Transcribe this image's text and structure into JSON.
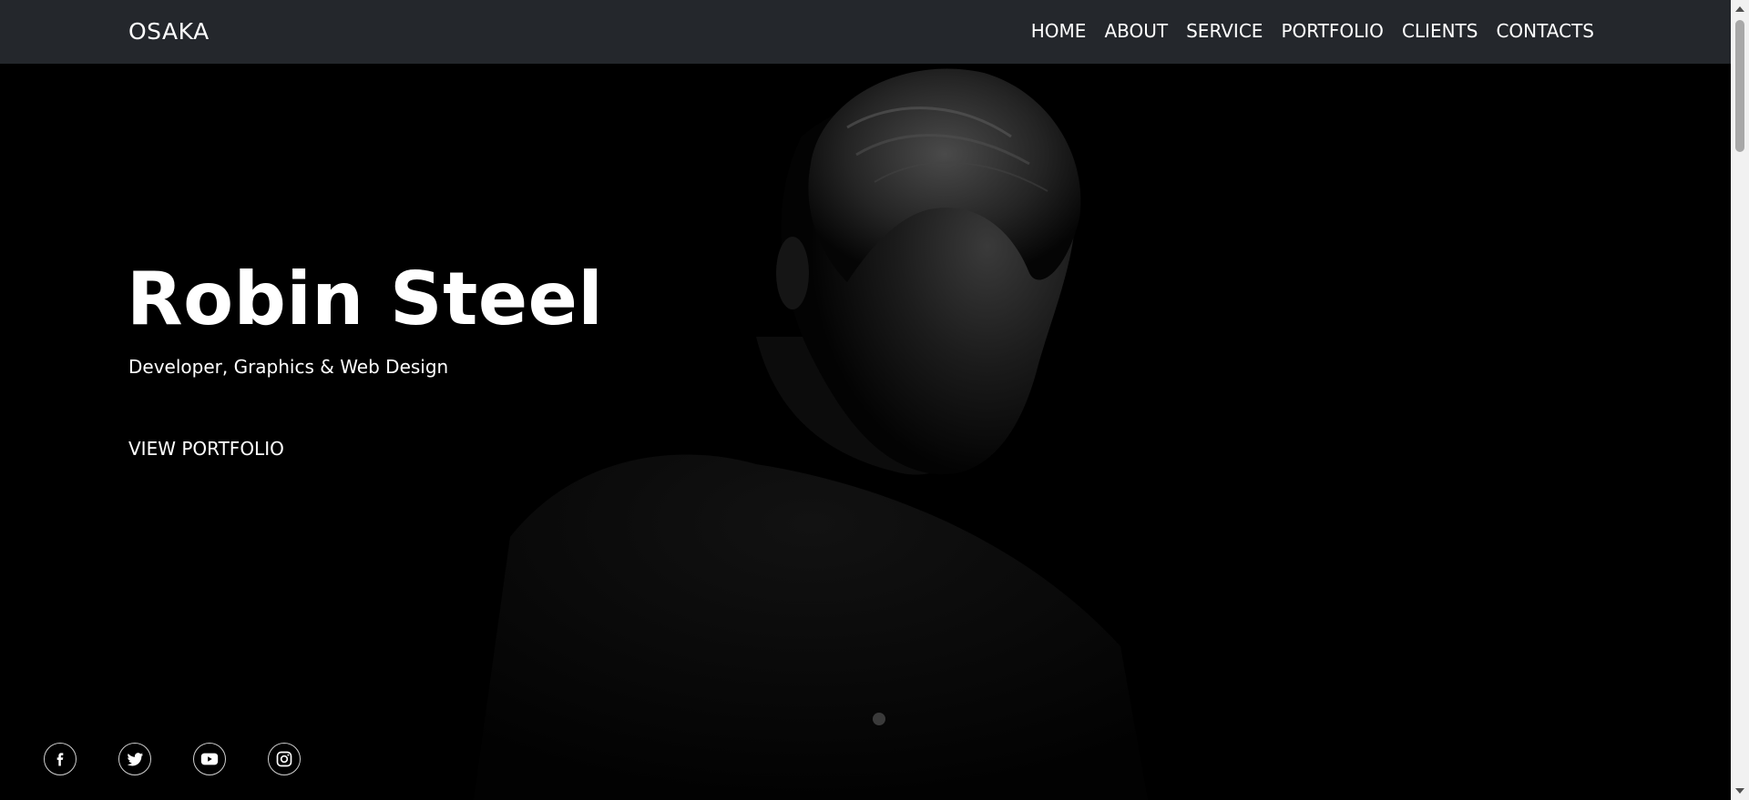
{
  "nav": {
    "brand": "OSAKA",
    "items": [
      {
        "label": "HOME"
      },
      {
        "label": "ABOUT"
      },
      {
        "label": "SERVICE"
      },
      {
        "label": "PORTFOLIO"
      },
      {
        "label": "CLIENTS"
      },
      {
        "label": "CONTACTS"
      }
    ]
  },
  "hero": {
    "title": "Robin Steel",
    "subtitle": "Developer, Graphics & Web Design",
    "cta_label": "VIEW PORTFOLIO"
  },
  "socials": [
    {
      "icon": "facebook-icon"
    },
    {
      "icon": "twitter-icon"
    },
    {
      "icon": "youtube-icon"
    },
    {
      "icon": "instagram-icon"
    }
  ],
  "colors": {
    "navbar_bg": "#24272c",
    "hero_bg": "#000000",
    "text": "#ffffff"
  }
}
